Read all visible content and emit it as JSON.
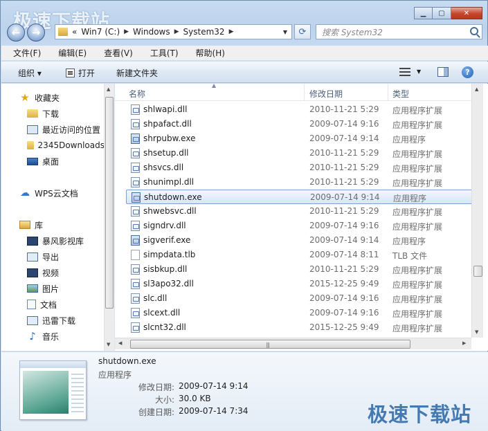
{
  "watermark": "极速下载站",
  "window": {
    "caption": {
      "minimize": "▁",
      "maximize": "▢",
      "close": "✕"
    }
  },
  "address": {
    "prefix": "«",
    "crumbs": [
      "Win7 (C:)",
      "Windows",
      "System32"
    ],
    "search_placeholder": "搜索 System32"
  },
  "menu": [
    "文件(F)",
    "编辑(E)",
    "查看(V)",
    "工具(T)",
    "帮助(H)"
  ],
  "toolbar": {
    "organize": "组织 ▾",
    "open": "打开",
    "new_folder": "新建文件夹",
    "help": "?"
  },
  "nav": {
    "items": [
      {
        "label": "收藏夹",
        "icon": "star-icon"
      },
      {
        "label": "下载",
        "icon": "folder-icon"
      },
      {
        "label": "最近访问的位置",
        "icon": "recent-places-icon"
      },
      {
        "label": "2345Downloads",
        "icon": "folder-icon"
      },
      {
        "label": "桌面",
        "icon": "desktop-icon"
      },
      {
        "label": "WPS云文档",
        "icon": "cloud-icon"
      },
      {
        "label": "库",
        "icon": "library-icon"
      },
      {
        "label": "暴风影视库",
        "icon": "video-library-icon"
      },
      {
        "label": "导出",
        "icon": "export-icon"
      },
      {
        "label": "视频",
        "icon": "video-icon"
      },
      {
        "label": "图片",
        "icon": "picture-icon"
      },
      {
        "label": "文档",
        "icon": "document-icon"
      },
      {
        "label": "迅雷下载",
        "icon": "download-icon"
      },
      {
        "label": "音乐",
        "icon": "music-icon"
      }
    ]
  },
  "columns": {
    "name": "名称",
    "date": "修改日期",
    "type": "类型"
  },
  "files": [
    {
      "name": "shlwapi.dll",
      "date": "2010-11-21 5:29",
      "type": "应用程序扩展",
      "kind": "dll"
    },
    {
      "name": "shpafact.dll",
      "date": "2009-07-14 9:16",
      "type": "应用程序扩展",
      "kind": "dll"
    },
    {
      "name": "shrpubw.exe",
      "date": "2009-07-14 9:14",
      "type": "应用程序",
      "kind": "exe"
    },
    {
      "name": "shsetup.dll",
      "date": "2010-11-21 5:29",
      "type": "应用程序扩展",
      "kind": "dll"
    },
    {
      "name": "shsvcs.dll",
      "date": "2010-11-21 5:29",
      "type": "应用程序扩展",
      "kind": "dll"
    },
    {
      "name": "shunimpl.dll",
      "date": "2010-11-21 5:29",
      "type": "应用程序扩展",
      "kind": "dll"
    },
    {
      "name": "shutdown.exe",
      "date": "2009-07-14 9:14",
      "type": "应用程序",
      "kind": "exe",
      "selected": true
    },
    {
      "name": "shwebsvc.dll",
      "date": "2010-11-21 5:29",
      "type": "应用程序扩展",
      "kind": "dll"
    },
    {
      "name": "signdrv.dll",
      "date": "2009-07-14 9:16",
      "type": "应用程序扩展",
      "kind": "dll"
    },
    {
      "name": "sigverif.exe",
      "date": "2009-07-14 9:14",
      "type": "应用程序",
      "kind": "exe"
    },
    {
      "name": "simpdata.tlb",
      "date": "2009-07-14 8:11",
      "type": "TLB 文件",
      "kind": "tlb"
    },
    {
      "name": "sisbkup.dll",
      "date": "2010-11-21 5:29",
      "type": "应用程序扩展",
      "kind": "dll"
    },
    {
      "name": "sl3apo32.dll",
      "date": "2015-12-25 9:49",
      "type": "应用程序扩展",
      "kind": "dll"
    },
    {
      "name": "slc.dll",
      "date": "2009-07-14 9:16",
      "type": "应用程序扩展",
      "kind": "dll"
    },
    {
      "name": "slcext.dll",
      "date": "2009-07-14 9:16",
      "type": "应用程序扩展",
      "kind": "dll"
    },
    {
      "name": "slcnt32.dll",
      "date": "2015-12-25 9:49",
      "type": "应用程序扩展",
      "kind": "dll"
    }
  ],
  "details": {
    "name": "shutdown.exe",
    "type": "应用程序",
    "modified_label": "修改日期:",
    "modified": "2009-07-14 9:14",
    "size_label": "大小:",
    "size": "30.0 KB",
    "created_label": "创建日期:",
    "created": "2009-07-14 7:34"
  }
}
